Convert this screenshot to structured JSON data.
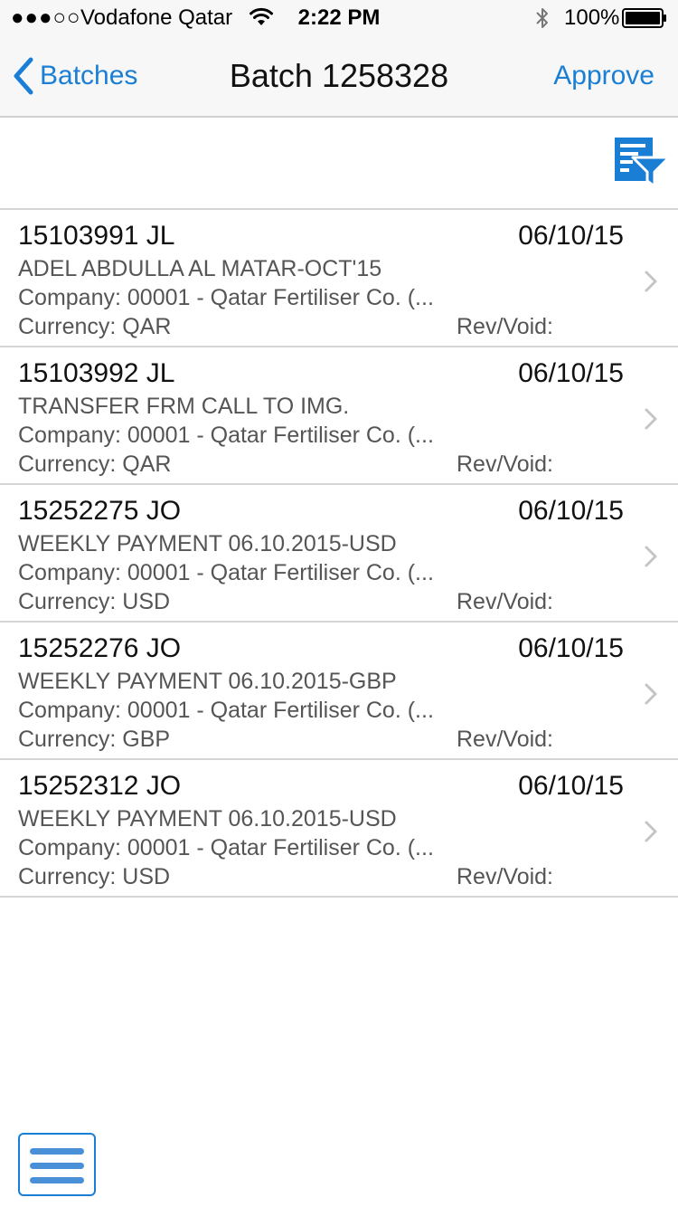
{
  "status_bar": {
    "signal": "●●●○○",
    "carrier": "Vodafone Qatar",
    "time": "2:22 PM",
    "battery_percent": "100%",
    "icons": [
      "wifi-icon",
      "bluetooth-icon",
      "battery-icon"
    ]
  },
  "nav": {
    "back_label": "Batches",
    "title": "Batch 1258328",
    "action_label": "Approve",
    "accent_color": "#1a7fd4"
  },
  "filter": {
    "icon": "filter-icon"
  },
  "batches": [
    {
      "id": "15103991 JL",
      "date": "06/10/15",
      "description": "ADEL ABDULLA AL MATAR-OCT'15",
      "company": "Company: 00001 - Qatar Fertiliser Co. (...",
      "currency": "Currency: QAR",
      "rev_void": "Rev/Void:"
    },
    {
      "id": "15103992 JL",
      "date": "06/10/15",
      "description": "TRANSFER FRM CALL TO IMG.",
      "company": "Company: 00001 - Qatar Fertiliser Co. (...",
      "currency": "Currency: QAR",
      "rev_void": "Rev/Void:"
    },
    {
      "id": "15252275 JO",
      "date": "06/10/15",
      "description": "WEEKLY PAYMENT 06.10.2015-USD",
      "company": "Company: 00001 - Qatar Fertiliser Co. (...",
      "currency": "Currency: USD",
      "rev_void": "Rev/Void:"
    },
    {
      "id": "15252276 JO",
      "date": "06/10/15",
      "description": "WEEKLY PAYMENT 06.10.2015-GBP",
      "company": "Company: 00001 - Qatar Fertiliser Co. (...",
      "currency": "Currency: GBP",
      "rev_void": "Rev/Void:"
    },
    {
      "id": "15252312 JO",
      "date": "06/10/15",
      "description": "WEEKLY PAYMENT 06.10.2015-USD",
      "company": "Company: 00001 - Qatar Fertiliser Co. (...",
      "currency": "Currency: USD",
      "rev_void": "Rev/Void:"
    }
  ],
  "bottom": {
    "menu_icon": "hamburger-menu-icon"
  }
}
